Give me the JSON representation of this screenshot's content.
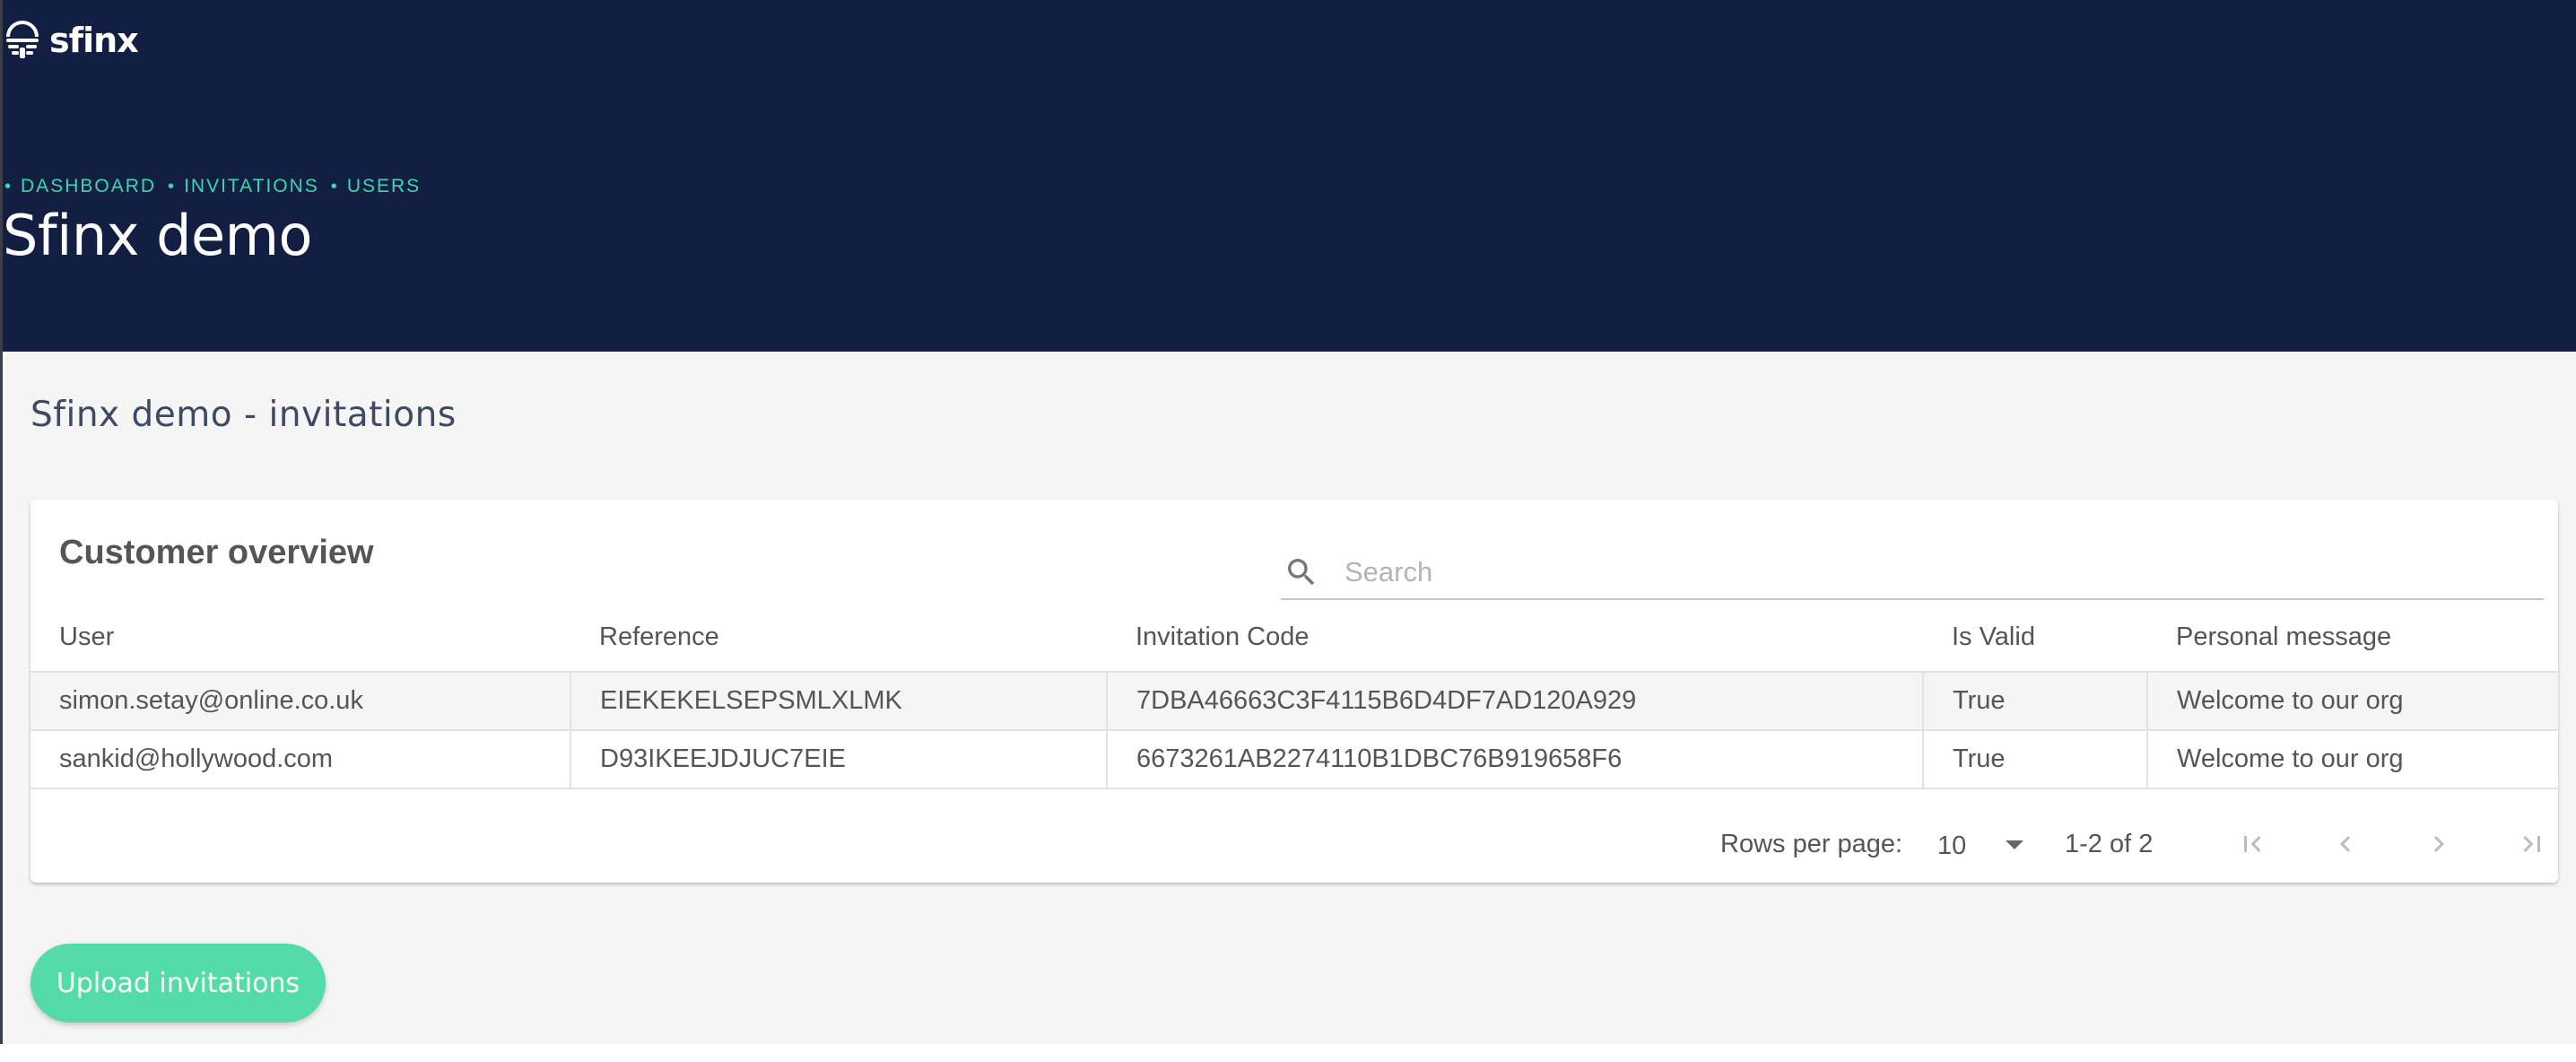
{
  "brand": {
    "logo_text": "sfinx"
  },
  "header": {
    "breadcrumb": [
      "DASHBOARD",
      "INVITATIONS",
      "USERS"
    ],
    "breadcrumb_bullet": "•",
    "title": "Sfinx demo"
  },
  "main": {
    "section_title": "Sfinx demo - invitations",
    "card": {
      "title": "Customer overview",
      "search": {
        "placeholder": "Search",
        "value": ""
      },
      "table": {
        "columns": [
          "User",
          "Reference",
          "Invitation Code",
          "Is Valid",
          "Personal message"
        ],
        "rows": [
          [
            "simon.setay@online.co.uk",
            "EIEKEKELSEPSMLXLMK",
            "7DBA46663C3F4115B6D4DF7AD120A929",
            "True",
            "Welcome to our org"
          ],
          [
            "sankid@hollywood.com",
            "D93IKEEJDJUC7EIE",
            "6673261AB2274110B1DBC76B919658F6",
            "True",
            "Welcome to our org"
          ]
        ]
      },
      "pagination": {
        "rows_per_page_label": "Rows per page:",
        "rows_per_page_value": "10",
        "range_text": "1-2 of 2"
      }
    },
    "upload_label": "Upload invitations"
  },
  "colors": {
    "header_bg": "#131f42",
    "accent": "#3ed6ae",
    "button_bg": "#53dca8",
    "page_bg": "#f5f5f5",
    "section_title": "#3e4a64"
  },
  "icons": {
    "logo": "fingerprint-stripes-icon",
    "search": "search-icon",
    "dropdown": "caret-down-icon",
    "first_page": "first-page-icon",
    "prev_page": "chevron-left-icon",
    "next_page": "chevron-right-icon",
    "last_page": "last-page-icon"
  }
}
